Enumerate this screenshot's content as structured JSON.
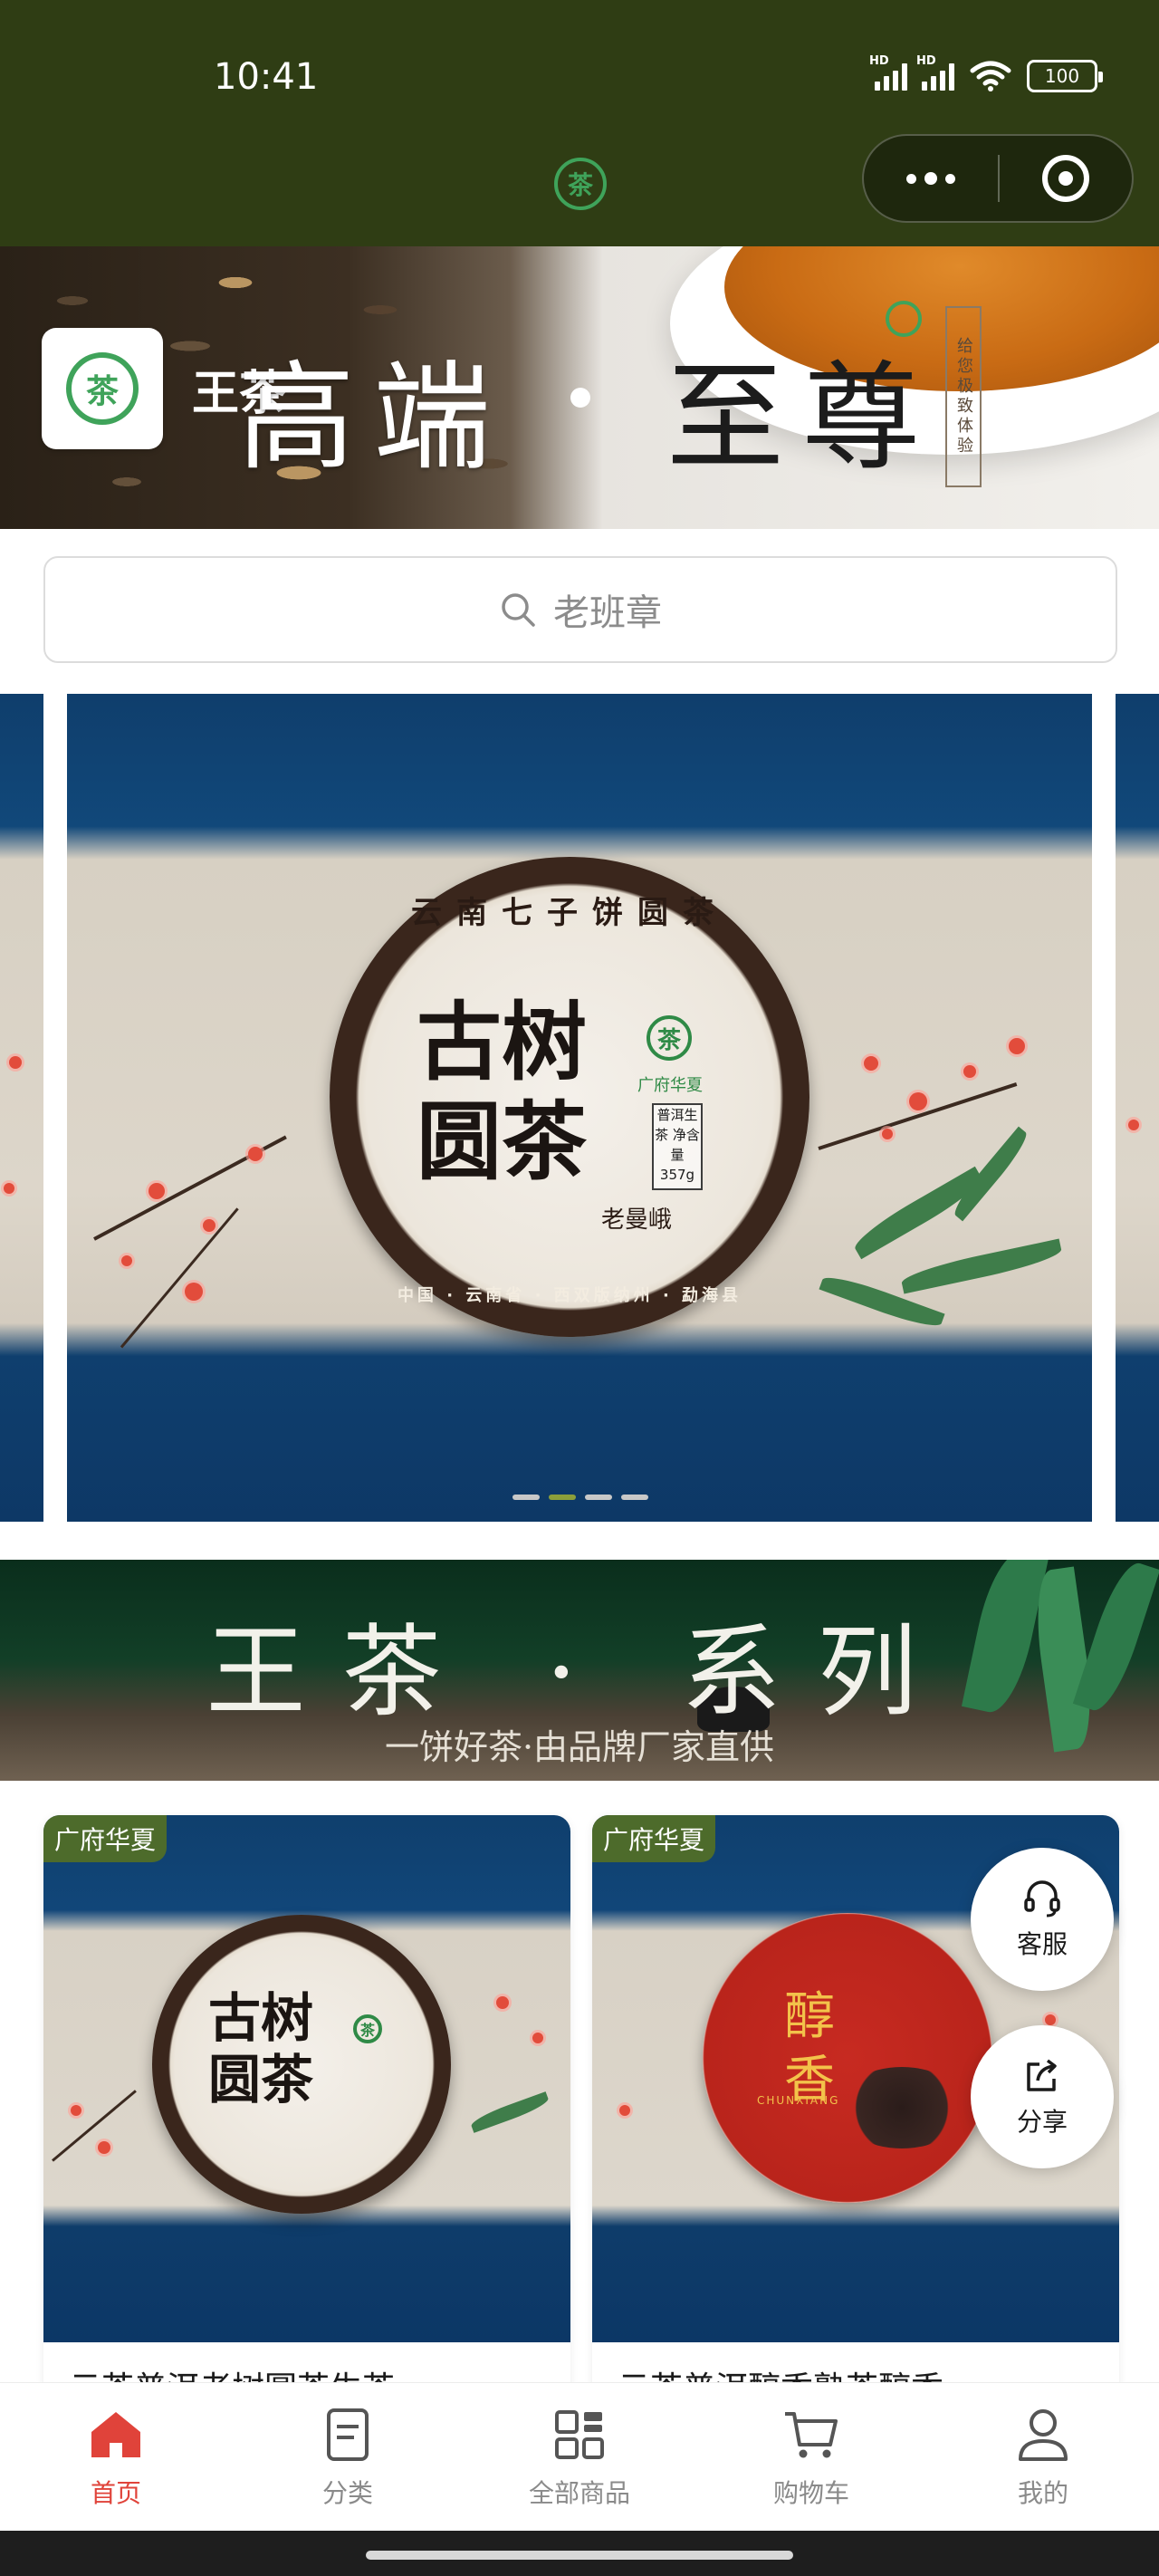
{
  "status_bar": {
    "time": "10:41",
    "signal_labels": [
      "HD",
      "HD"
    ],
    "battery": "100"
  },
  "nav": {
    "logo_glyph": "茶",
    "logo_icon": "tea-logo-icon",
    "more_icon": "more-dots-icon",
    "close_icon": "target-close-icon"
  },
  "header_banner": {
    "brand_name": "王茶",
    "logo_glyph": "茶",
    "slogan_left": "高端",
    "slogan_right": "至尊",
    "vertical_text": "给您极致体验"
  },
  "search": {
    "placeholder": "老班章",
    "icon": "search-icon"
  },
  "carousel": {
    "cake_ring_text": "云南七子饼圆茶",
    "cake_title": "古树圆茶",
    "cake_sub": "老曼峨",
    "cake_logo": "茶",
    "cake_brand": "广府华夏",
    "cake_stamp": "普洱生茶 净含量357g",
    "cake_bottom": "中国 · 云南省 · 西双版纳州 · 勐海县",
    "slide_count": 4,
    "active_index": 1
  },
  "series_banner": {
    "title": "王茶 · 系列",
    "subtitle": "一饼好茶·由品牌厂家直供"
  },
  "products": [
    {
      "tag": "广府华夏",
      "name": "云茶普洱老树圆茶生茶",
      "image": "tea-cake-ancient-tree"
    },
    {
      "tag": "广府华夏",
      "name": "云茶普洱醇香熟茶醇香",
      "image": "tea-cake-chunxiang"
    }
  ],
  "red_cake": {
    "title": "醇香",
    "pinyin": "CHUNXIANG"
  },
  "floating": {
    "service_label": "客服",
    "share_label": "分享"
  },
  "tabbar": {
    "items": [
      {
        "label": "首页",
        "icon": "home-icon",
        "active": true
      },
      {
        "label": "分类",
        "icon": "category-icon",
        "active": false
      },
      {
        "label": "全部商品",
        "icon": "grid-icon",
        "active": false
      },
      {
        "label": "购物车",
        "icon": "cart-icon",
        "active": false
      },
      {
        "label": "我的",
        "icon": "user-icon",
        "active": false
      }
    ]
  },
  "colors": {
    "topbar": "#2f3d14",
    "accent_active": "#e0433a",
    "tag_bg": "#4d6b2b",
    "brand_green": "#3fa35a"
  }
}
